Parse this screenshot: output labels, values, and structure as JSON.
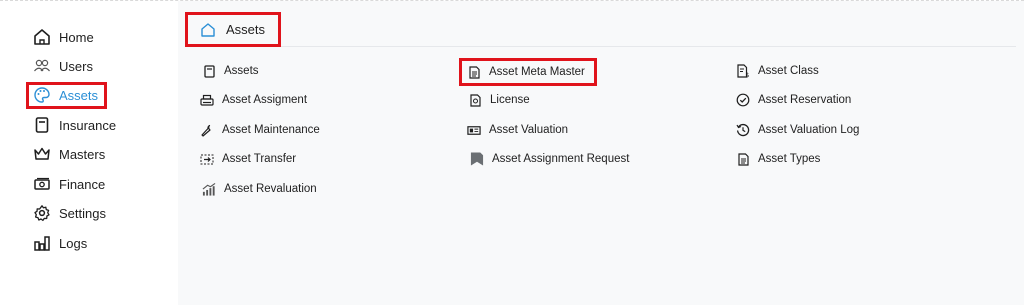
{
  "sidebar": {
    "items": [
      {
        "label": "Home",
        "icon": "home-icon"
      },
      {
        "label": "Users",
        "icon": "users-icon"
      },
      {
        "label": "Assets",
        "icon": "palette-icon",
        "active": true
      },
      {
        "label": "Insurance",
        "icon": "document-icon"
      },
      {
        "label": "Masters",
        "icon": "crown-icon"
      },
      {
        "label": "Finance",
        "icon": "money-icon"
      },
      {
        "label": "Settings",
        "icon": "gear-icon"
      },
      {
        "label": "Logs",
        "icon": "bar-chart-icon"
      }
    ]
  },
  "breadcrumb": {
    "label": "Assets",
    "icon": "home-icon"
  },
  "links": {
    "col1": [
      "Assets",
      "Asset Assigment",
      "Asset Maintenance",
      "Asset Transfer",
      "Asset Revaluation"
    ],
    "col2": [
      "Asset Meta Master",
      "License",
      "Asset Valuation",
      "Asset Assignment Request"
    ],
    "col3": [
      "Asset Class",
      "Asset Reservation",
      "Asset Valuation Log",
      "Asset Types"
    ]
  },
  "colors": {
    "accent": "#2b8fd6",
    "highlight": "#e0131b",
    "panel": "#f8f9fa"
  }
}
